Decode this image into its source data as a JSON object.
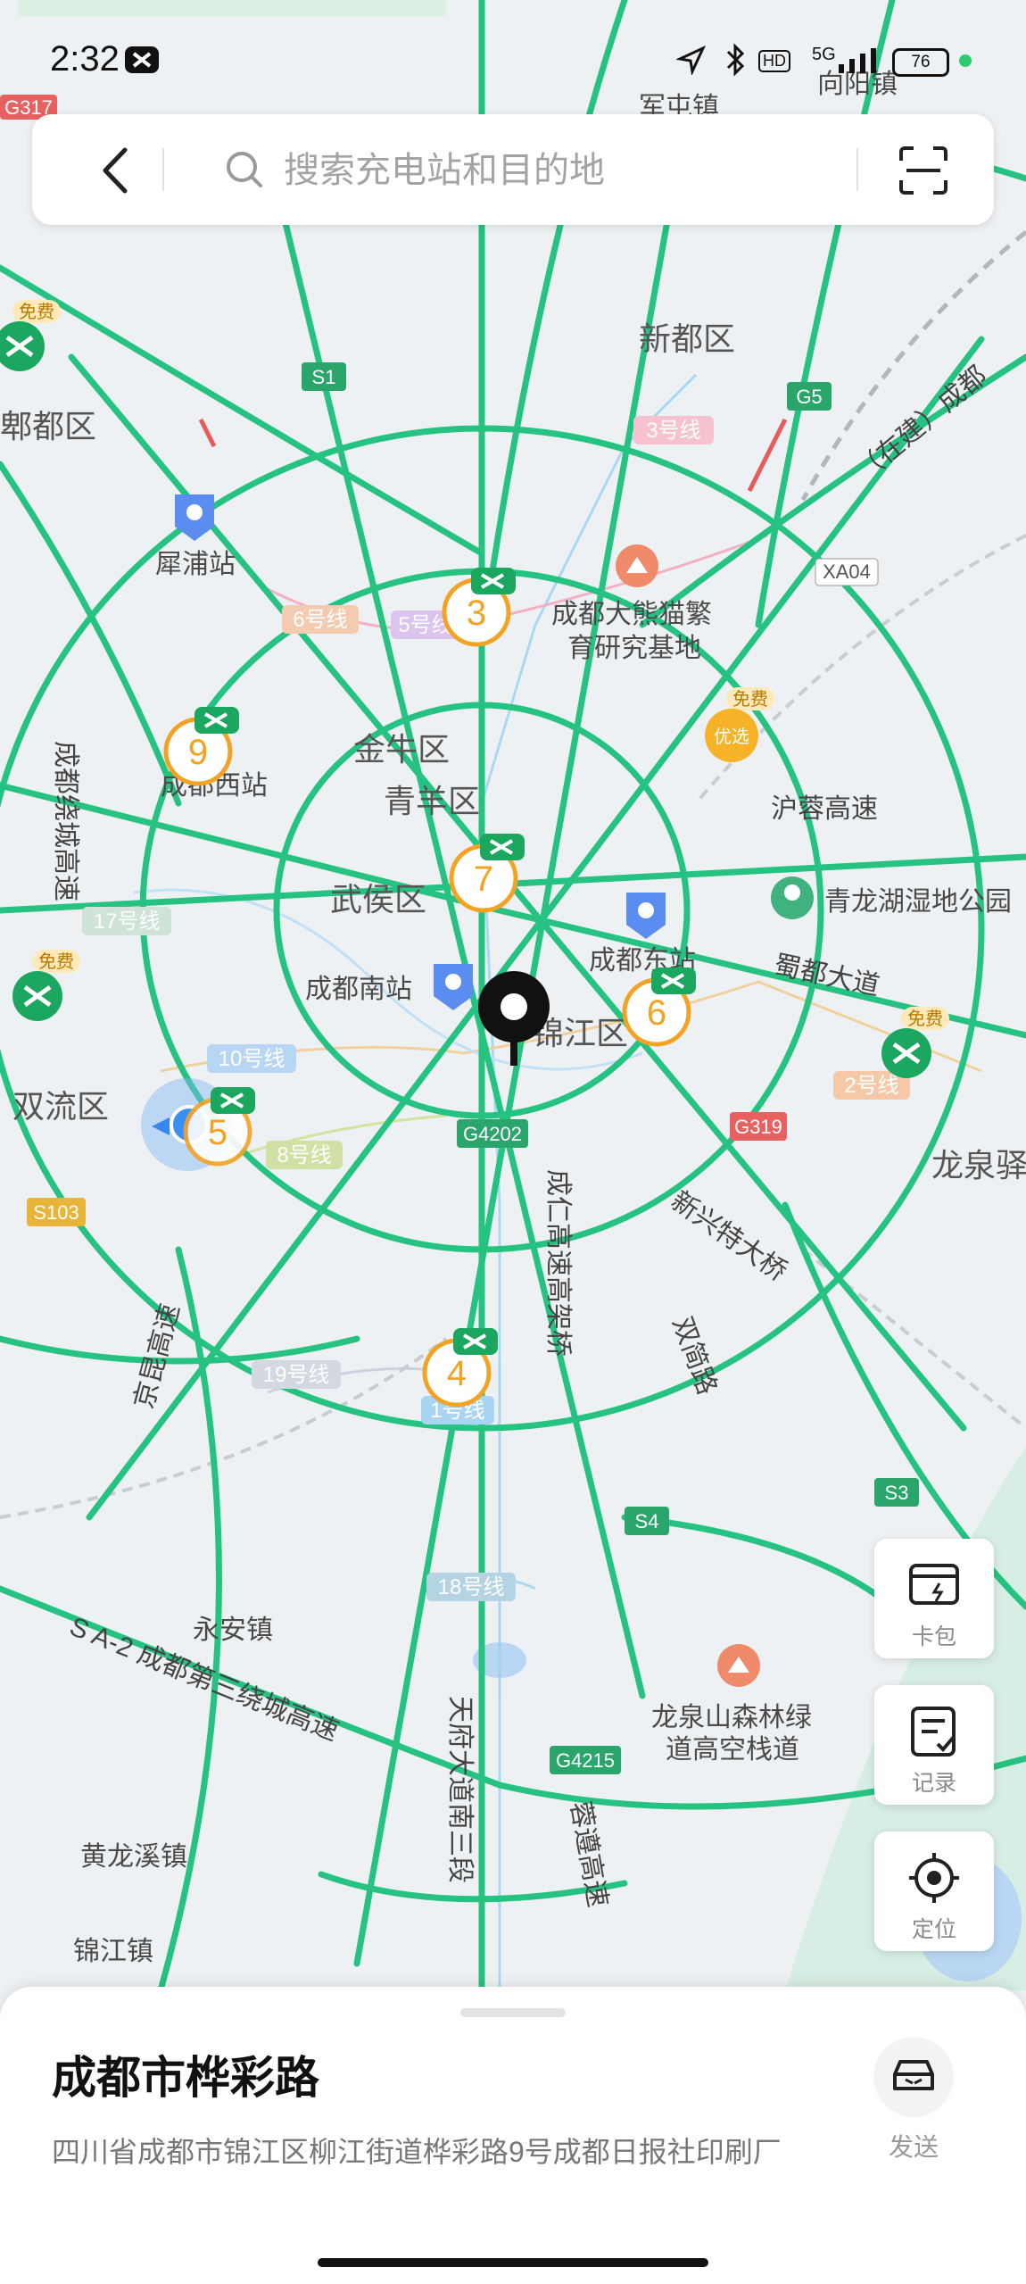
{
  "status_bar": {
    "time": "2:32",
    "network": "5G",
    "hd": "HD",
    "battery": "76"
  },
  "search": {
    "placeholder": "搜索充电站和目的地"
  },
  "map": {
    "districts": [
      {
        "name": "新都区"
      },
      {
        "name": "金牛区"
      },
      {
        "name": "青羊区"
      },
      {
        "name": "武侯区"
      },
      {
        "name": "锦江区"
      },
      {
        "name": "双流区"
      },
      {
        "name": "龙泉驿"
      },
      {
        "name": "郫都区"
      }
    ],
    "places": [
      {
        "name": "成都大熊猫繁"
      },
      {
        "name": "育研究基地"
      },
      {
        "name": "犀浦站"
      },
      {
        "name": "成都西站"
      },
      {
        "name": "成都东站"
      },
      {
        "name": "成都南站"
      },
      {
        "name": "青龙湖湿地公园"
      },
      {
        "name": "永安镇"
      },
      {
        "name": "黄龙溪镇"
      },
      {
        "name": "锦江镇"
      },
      {
        "name": "龙泉山森林绿"
      },
      {
        "name": "道高空栈道"
      },
      {
        "name": "向阳镇"
      },
      {
        "name": "军屯镇"
      }
    ],
    "roads": [
      {
        "name": "沪蓉高速"
      },
      {
        "name": "蜀都大道"
      },
      {
        "name": "京昆高速"
      },
      {
        "name": "成都绕城高速"
      },
      {
        "name": "成仁高速高架桥"
      },
      {
        "name": "新兴特大桥"
      },
      {
        "name": "双简路"
      },
      {
        "name": "天府大道南三段"
      },
      {
        "name": "蓉遵高速"
      },
      {
        "name": "S A-2 成都第三绕城高速"
      },
      {
        "name": "（在建）成都"
      }
    ],
    "road_shields": [
      "S1",
      "G5",
      "XA04",
      "G4202",
      "G319",
      "S103",
      "S4",
      "S3",
      "G4215",
      "G317"
    ],
    "metro_lines": [
      "3号线",
      "6号线",
      "5号线",
      "10号线",
      "8号线",
      "17号线",
      "19号线",
      "1号线",
      "18号线",
      "2号线"
    ],
    "station_clusters": [
      {
        "count": "3"
      },
      {
        "count": "9"
      },
      {
        "count": "7"
      },
      {
        "count": "6"
      },
      {
        "count": "5"
      },
      {
        "count": "4"
      }
    ],
    "free_badge": "免费",
    "premium_badge": "优选"
  },
  "side_buttons": {
    "wallet": "卡包",
    "records": "记录",
    "locate": "定位"
  },
  "location_card": {
    "name": "成都市桦彩路",
    "address": "四川省成都市锦江区柳江街道桦彩路9号成都日报社印刷厂",
    "send_label": "发送"
  }
}
